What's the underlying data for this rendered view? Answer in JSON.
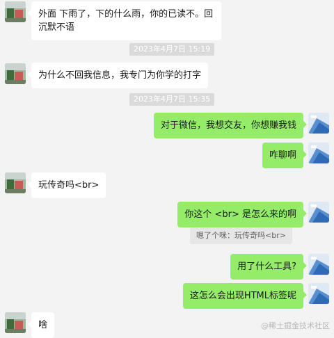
{
  "messages": [
    {
      "side": "left",
      "text": "外面 下雨了，下的什么雨，你的已读不。回沉默不语"
    },
    {
      "type": "time",
      "text": "2023年4月7日 15:19"
    },
    {
      "side": "left",
      "text": "为什么不回我信息，我专门为你学的打字"
    },
    {
      "type": "time",
      "text": "2023年4月7日 15:35"
    },
    {
      "side": "right",
      "text": "对于微信，我想交友，你想赚我钱"
    },
    {
      "side": "right",
      "text": "咋聊啊"
    },
    {
      "side": "left",
      "text": "玩传奇吗<br>"
    },
    {
      "side": "right",
      "text": "你这个 <br> 是怎么来的啊"
    },
    {
      "type": "quote",
      "text": "嗯了个咪：玩传奇吗<br>"
    },
    {
      "side": "right",
      "text": "用了什么工具?"
    },
    {
      "side": "right",
      "text": "这怎么会出现HTML标签呢"
    },
    {
      "side": "left",
      "text": "啥"
    }
  ],
  "watermark": "@稀土掘金技术社区",
  "colors": {
    "background": "#f3f3f3",
    "bubble_self": "#95ec69",
    "bubble_other": "#ffffff"
  }
}
